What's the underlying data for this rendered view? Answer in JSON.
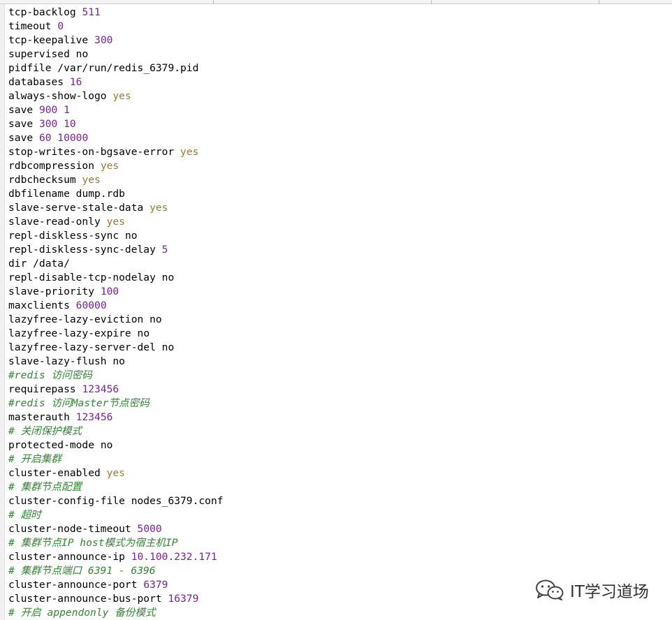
{
  "colors": {
    "number": "#7a1fa2",
    "keyword": "#9b7a2b",
    "comment": "#2e8b2e",
    "text": "#000000"
  },
  "editor": {
    "lines": [
      {
        "key": "tcp-backlog",
        "val": "511",
        "vtype": "num"
      },
      {
        "key": "timeout",
        "val": "0",
        "vtype": "num"
      },
      {
        "key": "tcp-keepalive",
        "val": "300",
        "vtype": "num"
      },
      {
        "key": "supervised",
        "val": "no",
        "vtype": "plain"
      },
      {
        "key": "pidfile",
        "val": "/var/run/redis_6379.pid",
        "vtype": "plain"
      },
      {
        "key": "databases",
        "val": "16",
        "vtype": "num"
      },
      {
        "key": "always-show-logo",
        "val": "yes",
        "vtype": "kw"
      },
      {
        "key": "save",
        "val": "900 1",
        "vtype": "num"
      },
      {
        "key": "save",
        "val": "300 10",
        "vtype": "num"
      },
      {
        "key": "save",
        "val": "60 10000",
        "vtype": "num"
      },
      {
        "key": "stop-writes-on-bgsave-error",
        "val": "yes",
        "vtype": "kw"
      },
      {
        "key": "rdbcompression",
        "val": "yes",
        "vtype": "kw"
      },
      {
        "key": "rdbchecksum",
        "val": "yes",
        "vtype": "kw"
      },
      {
        "key": "dbfilename",
        "val": "dump.rdb",
        "vtype": "plain"
      },
      {
        "key": "slave-serve-stale-data",
        "val": "yes",
        "vtype": "kw"
      },
      {
        "key": "slave-read-only",
        "val": "yes",
        "vtype": "kw"
      },
      {
        "key": "repl-diskless-sync",
        "val": "no",
        "vtype": "plain"
      },
      {
        "key": "repl-diskless-sync-delay",
        "val": "5",
        "vtype": "num"
      },
      {
        "key": "dir",
        "val": "/data/",
        "vtype": "plain"
      },
      {
        "key": "repl-disable-tcp-nodelay",
        "val": "no",
        "vtype": "plain"
      },
      {
        "key": "slave-priority",
        "val": "100",
        "vtype": "num"
      },
      {
        "key": "maxclients",
        "val": "60000",
        "vtype": "num"
      },
      {
        "key": "lazyfree-lazy-eviction",
        "val": "no",
        "vtype": "plain"
      },
      {
        "key": "lazyfree-lazy-expire",
        "val": "no",
        "vtype": "plain"
      },
      {
        "key": "lazyfree-lazy-server-del",
        "val": "no",
        "vtype": "plain"
      },
      {
        "key": "slave-lazy-flush",
        "val": "no",
        "vtype": "plain"
      },
      {
        "comment": "#redis 访问密码"
      },
      {
        "key": "requirepass",
        "val": "123456",
        "vtype": "num"
      },
      {
        "comment": "#redis 访问Master节点密码"
      },
      {
        "key": "masterauth",
        "val": "123456",
        "vtype": "num"
      },
      {
        "comment": "# 关闭保护模式"
      },
      {
        "key": "protected-mode",
        "val": "no",
        "vtype": "plain"
      },
      {
        "comment": "# 开启集群"
      },
      {
        "key": "cluster-enabled",
        "val": "yes",
        "vtype": "kw"
      },
      {
        "comment": "# 集群节点配置"
      },
      {
        "key": "cluster-config-file",
        "val": "nodes_6379.conf",
        "vtype": "plain"
      },
      {
        "comment": "# 超时"
      },
      {
        "key": "cluster-node-timeout",
        "val": "5000",
        "vtype": "num"
      },
      {
        "comment": "# 集群节点IP host模式为宿主机IP"
      },
      {
        "key": "cluster-announce-ip",
        "val": "10.100.232.171",
        "vtype": "num"
      },
      {
        "comment": "# 集群节点端口 6391 - 6396"
      },
      {
        "key": "cluster-announce-port",
        "val": "6379",
        "vtype": "num"
      },
      {
        "key": "cluster-announce-bus-port",
        "val": "16379",
        "vtype": "num"
      },
      {
        "comment": "# 开启 appendonly 备份模式"
      }
    ]
  },
  "watermark": {
    "icon": "wechat-icon",
    "text": "IT学习道场"
  }
}
